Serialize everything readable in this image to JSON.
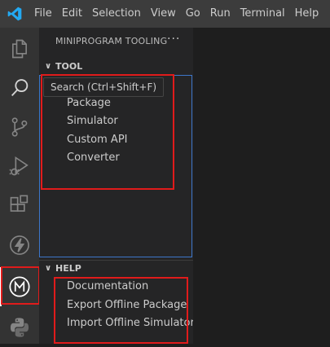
{
  "menu": {
    "items": [
      "File",
      "Edit",
      "Selection",
      "View",
      "Go",
      "Run",
      "Terminal",
      "Help"
    ]
  },
  "activity_bar": {
    "icons": [
      "explorer-icon",
      "search-icon",
      "source-control-icon",
      "run-debug-icon",
      "extensions-icon",
      "lightning-icon",
      "miniprogram-m-icon",
      "python-icon"
    ]
  },
  "tooltip": "Search (Ctrl+Shift+F)",
  "sidebar": {
    "title": "MINIPROGRAM TOOLING",
    "more": "···",
    "tool": {
      "title": "TOOL",
      "items": [
        "Package",
        "Simulator",
        "Custom API",
        "Converter"
      ]
    },
    "help": {
      "title": "HELP",
      "items": [
        "Documentation",
        "Export Offline Package",
        "Import Offline Simulator"
      ]
    }
  },
  "colors": {
    "titlebar": "#3c3c3c",
    "activitybar": "#333333",
    "sidebar": "#252526",
    "highlight_box": "#e01b1b",
    "focus_border": "#3d76c9",
    "vscode_blue": "#23a9f2"
  }
}
